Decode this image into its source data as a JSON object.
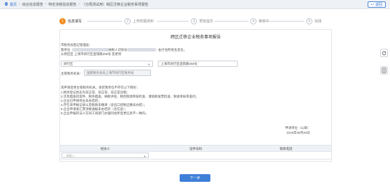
{
  "breadcrumb": {
    "home": "首页",
    "items": [
      "综合信息报告",
      "特定涉税信息报告",
      "（分局测试用）跨区迁移企业税务事项报告"
    ]
  },
  "back_label": "返回",
  "steps": [
    {
      "num": "1",
      "label": "信息填写",
      "active": true
    },
    {
      "num": "2",
      "label": "上传附报资料",
      "active": false
    },
    {
      "num": "3",
      "label": "预览提交",
      "active": false
    },
    {
      "num": "4",
      "label": "审核中",
      "active": false
    },
    {
      "num": "5",
      "label": "完成",
      "active": false
    }
  ],
  "doc": {
    "title": "跨区迁移企业税务事项报告",
    "addressee": "市税务局登记管理处：",
    "line1_a": "我单位（",
    "line1_b": "纳税人识别号",
    "line1_c": "）由于住所发生变化，",
    "line2": "从原区区 上海市闵行区直辖路258号 变更到",
    "district_value": "闵行区",
    "address_value": "上海市闵行区直辖路258号",
    "authority_label": "主管税务机关：",
    "authority_value": "国家税务总局上海市闵行区税务局",
    "intro": "现申请变更主管税务机关。承诺我单位不存在以下情形：",
    "items": [
      "1.税务登记状态为非正常、非正常、非正常注销；",
      "2.涉及稽查的案件、税务稽查、纳税评估、税控税源审核检查、增值税发票检查、税收审核审查的；",
      "3.企业已申请停业未办结的；",
      "4.存在未申报记录以及税款未缴清（含出口退税应缴未办结）；",
      "5.企业申请发汇票须要通报未办结的（含在途）；",
      "6.企业申报的法人在同工商部门办理的住所变更信息不一致的。"
    ],
    "signature": "申请单位（公章）",
    "date": "2019年09月26日"
  },
  "table": {
    "headers": [
      "经办人",
      "证件号码",
      "联系电话"
    ],
    "select_placeholder": "--请输入--"
  },
  "next_label": "下一步"
}
